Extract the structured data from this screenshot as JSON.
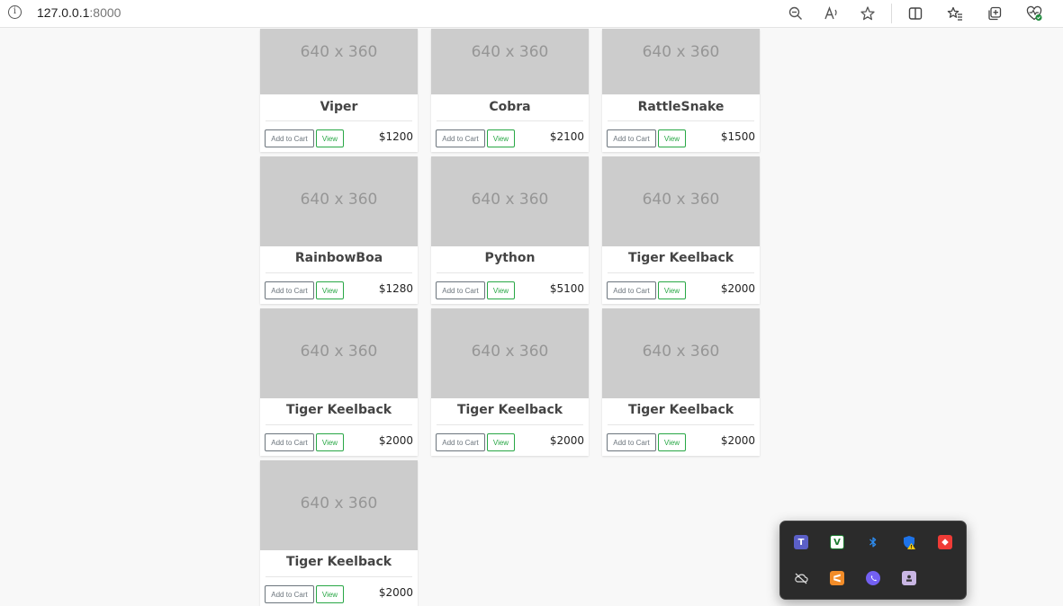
{
  "browser": {
    "url_host": "127.0.0.1",
    "url_port": ":8000",
    "toolbar_icons": [
      "zoom-icon",
      "read-aloud-icon",
      "favorite-star-icon",
      "split-screen-icon",
      "favorites-icon",
      "collections-icon",
      "browser-essentials-icon"
    ]
  },
  "products": [
    {
      "name": "Viper",
      "price": "$1200",
      "image_text": "640 x 360",
      "cart_label": "Add to Cart",
      "view_label": "View"
    },
    {
      "name": "Cobra",
      "price": "$2100",
      "image_text": "640 x 360",
      "cart_label": "Add to Cart",
      "view_label": "View"
    },
    {
      "name": "RattleSnake",
      "price": "$1500",
      "image_text": "640 x 360",
      "cart_label": "Add to Cart",
      "view_label": "View"
    },
    {
      "name": "RainbowBoa",
      "price": "$1280",
      "image_text": "640 x 360",
      "cart_label": "Add to Cart",
      "view_label": "View"
    },
    {
      "name": "Python",
      "price": "$5100",
      "image_text": "640 x 360",
      "cart_label": "Add to Cart",
      "view_label": "View"
    },
    {
      "name": "Tiger Keelback",
      "price": "$2000",
      "image_text": "640 x 360",
      "cart_label": "Add to Cart",
      "view_label": "View"
    },
    {
      "name": "Tiger Keelback",
      "price": "$2000",
      "image_text": "640 x 360",
      "cart_label": "Add to Cart",
      "view_label": "View"
    },
    {
      "name": "Tiger Keelback",
      "price": "$2000",
      "image_text": "640 x 360",
      "cart_label": "Add to Cart",
      "view_label": "View"
    },
    {
      "name": "Tiger Keelback",
      "price": "$2000",
      "image_text": "640 x 360",
      "cart_label": "Add to Cart",
      "view_label": "View"
    },
    {
      "name": "Tiger Keelback",
      "price": "$2000",
      "image_text": "640 x 360",
      "cart_label": "Add to Cart",
      "view_label": "View"
    }
  ],
  "tray": {
    "icons": [
      {
        "name": "teams-icon",
        "color": "#5b5fc7",
        "glyph": "T"
      },
      {
        "name": "veracrypt-icon",
        "color": "#ffffff",
        "glyph": "V"
      },
      {
        "name": "bluetooth-icon",
        "color": "#1e73e8",
        "glyph": "ʙ"
      },
      {
        "name": "windows-security-warning-icon",
        "color": "#1e73e8",
        "glyph": "!"
      },
      {
        "name": "anydesk-icon",
        "color": "#ef3b36",
        "glyph": "◆"
      },
      {
        "name": "onedrive-offline-icon",
        "color": "#2b2b2b",
        "glyph": "☁"
      },
      {
        "name": "sublime-text-icon",
        "color": "#f28c28",
        "glyph": "S"
      },
      {
        "name": "viber-icon",
        "color": "#7360f2",
        "glyph": "✆"
      },
      {
        "name": "app-tray-icon",
        "color": "#c9b6e4",
        "glyph": "◘"
      }
    ]
  },
  "colors": {
    "view_button": "#28a745",
    "cart_button": "#6c757d",
    "image_placeholder": "#cccccc"
  }
}
